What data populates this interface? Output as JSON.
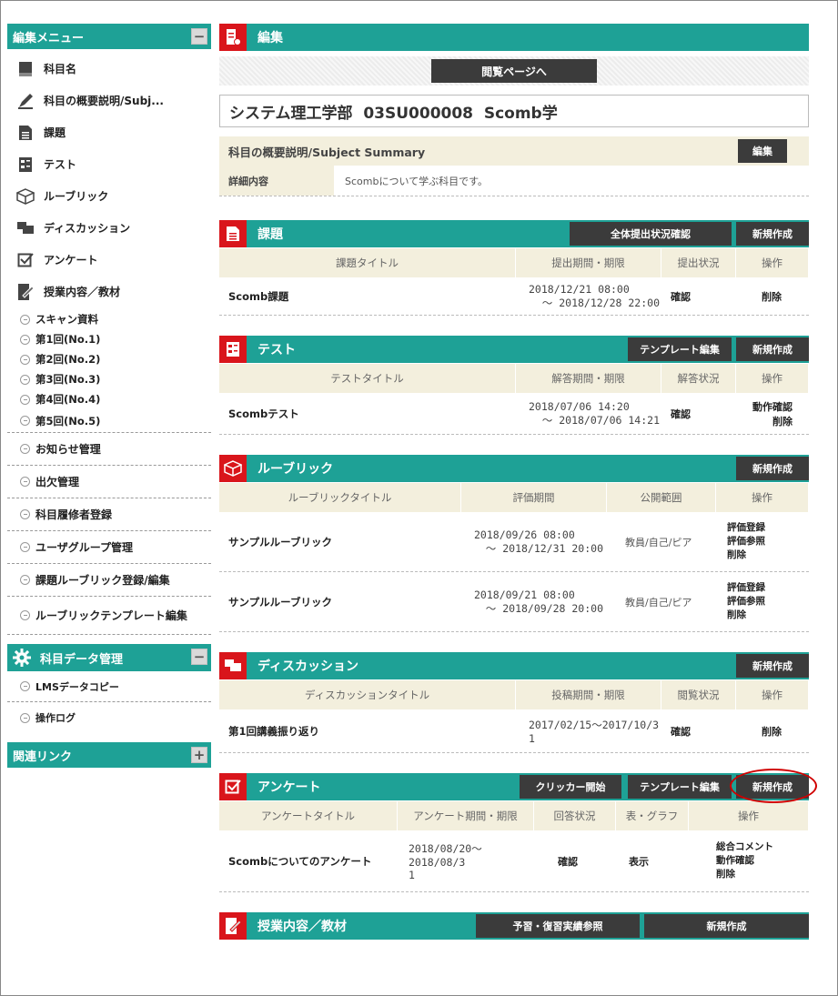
{
  "sidebar": {
    "menu_title": "編集メニュー",
    "menu_toggle": "−",
    "items": [
      {
        "label": "科目名",
        "icon": "book-icon"
      },
      {
        "label": "科目の概要説明/Subj...",
        "icon": "pen-icon"
      },
      {
        "label": "課題",
        "icon": "document-icon"
      },
      {
        "label": "テスト",
        "icon": "test-icon"
      },
      {
        "label": "ルーブリック",
        "icon": "rubric-icon"
      },
      {
        "label": "ディスカッション",
        "icon": "chat-icon"
      },
      {
        "label": "アンケート",
        "icon": "checkbox-icon"
      },
      {
        "label": "授業内容／教材",
        "icon": "material-icon"
      }
    ],
    "sub_items": [
      "スキャン資料",
      "第1回(No.1)",
      "第2回(No.2)",
      "第3回(No.3)",
      "第4回(No.4)",
      "第5回(No.5)"
    ],
    "sep_items": [
      "お知らせ管理",
      "出欠管理",
      "科目履修者登録",
      "ユーザグループ管理",
      "課題ルーブリック登録/編集",
      "ルーブリックテンプレート編集"
    ],
    "data_title": "科目データ管理",
    "data_toggle": "−",
    "data_items": [
      "LMSデータコピー",
      "操作ログ"
    ],
    "links_title": "関連リンク",
    "links_toggle": "+"
  },
  "header": {
    "title": "編集",
    "view_page_button": "閲覧ページへ",
    "course_title": "システム理工学部  03SU000008  Scomb学"
  },
  "summary": {
    "title": "科目の概要説明/Subject Summary",
    "edit_button": "編集",
    "detail_label": "詳細内容",
    "detail_value": "Scombについて学ぶ科目です。"
  },
  "assignment": {
    "title": "課題",
    "btn_status": "全体提出状況確認",
    "btn_new": "新規作成",
    "columns": [
      "課題タイトル",
      "提出期間・期限",
      "提出状況",
      "操作"
    ],
    "rows": [
      {
        "title": "Scomb課題",
        "period1": "2018/12/21 08:00",
        "period2": "～ 2018/12/28 22:00",
        "status": "確認",
        "ops": [
          "削除"
        ]
      }
    ]
  },
  "test": {
    "title": "テスト",
    "btn_template": "テンプレート編集",
    "btn_new": "新規作成",
    "columns": [
      "テストタイトル",
      "解答期間・期限",
      "解答状況",
      "操作"
    ],
    "rows": [
      {
        "title": "Scombテスト",
        "period1": "2018/07/06 14:20",
        "period2": "～ 2018/07/06 14:21",
        "status": "確認",
        "ops": [
          "動作確認",
          "削除"
        ]
      }
    ]
  },
  "rubric": {
    "title": "ルーブリック",
    "btn_new": "新規作成",
    "columns": [
      "ルーブリックタイトル",
      "評価期間",
      "公開範囲",
      "操作"
    ],
    "rows": [
      {
        "title": "サンプルルーブリック",
        "period1": "2018/09/26 08:00",
        "period2": "～ 2018/12/31 20:00",
        "scope": "教員/自己/ピア",
        "ops": [
          "評価登録",
          "評価参照",
          "削除"
        ]
      },
      {
        "title": "サンプルルーブリック",
        "period1": "2018/09/21 08:00",
        "period2": "～ 2018/09/28 20:00",
        "scope": "教員/自己/ピア",
        "ops": [
          "評価登録",
          "評価参照",
          "削除"
        ]
      }
    ]
  },
  "discussion": {
    "title": "ディスカッション",
    "btn_new": "新規作成",
    "columns": [
      "ディスカッションタイトル",
      "投稿期間・期限",
      "閲覧状況",
      "操作"
    ],
    "rows": [
      {
        "title": "第1回講義振り返り",
        "period1": "2017/02/15～2017/10/3",
        "period2": "1",
        "status": "確認",
        "ops": [
          "削除"
        ]
      }
    ]
  },
  "survey": {
    "title": "アンケート",
    "btn_clicker": "クリッカー開始",
    "btn_template": "テンプレート編集",
    "btn_new": "新規作成",
    "columns": [
      "アンケートタイトル",
      "アンケート期間・期限",
      "回答状況",
      "表・グラフ",
      "操作"
    ],
    "rows": [
      {
        "title": "Scombについてのアンケート",
        "period1": "2018/08/20～2018/08/3",
        "period2": "1",
        "status": "確認",
        "graph": "表示",
        "ops": [
          "総合コメント",
          "動作確認",
          "削除"
        ]
      }
    ]
  },
  "materials": {
    "title": "授業内容／教材",
    "btn_review": "予習・復習実績参照",
    "btn_new": "新規作成"
  },
  "colors": {
    "teal": "#1ea196",
    "red": "#d9151b",
    "dark": "#3b3b3b",
    "beige": "#f3efdd",
    "highlight": "#d00000"
  }
}
